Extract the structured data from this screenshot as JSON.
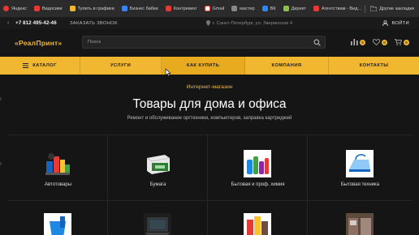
{
  "bookmarks": {
    "items": [
      {
        "label": "Яндекс",
        "color": "#e53935"
      },
      {
        "label": "Видосики",
        "color": "#e53935"
      },
      {
        "label": "Тупить в графики",
        "color": "#f1b731"
      },
      {
        "label": "Бизнес бабки",
        "color": "#3b82f6"
      },
      {
        "label": "Контрекинг",
        "color": "#e53935"
      },
      {
        "label": "Gmail",
        "color": "#ea4335"
      },
      {
        "label": "мастер",
        "color": "#888888"
      },
      {
        "label": "ВК",
        "color": "#2787f5"
      },
      {
        "label": "Директ",
        "color": "#8bc34a"
      },
      {
        "label": "Агентствам - Вид...",
        "color": "#e53935"
      }
    ],
    "other_label": "Другие закладки"
  },
  "topbar": {
    "phone": "+7 812 495-42-46",
    "callback": "ЗАКАЗАТЬ ЗВОНОК",
    "address": "г. Санкт-Петербург, ул. Зверинская 4",
    "login": "ВОЙТИ"
  },
  "header": {
    "logo": "«РеалПринт»",
    "search_placeholder": "Поиск",
    "compare_count": "0",
    "favorites_count": "0",
    "cart_count": "0"
  },
  "nav": {
    "items": [
      {
        "label": "КАТАЛОГ"
      },
      {
        "label": "УСЛУГИ"
      },
      {
        "label": "КАК КУПИТЬ"
      },
      {
        "label": "КОМПАНИЯ"
      },
      {
        "label": "КОНТАКТЫ"
      }
    ]
  },
  "hero": {
    "eyebrow": "Интернет-магазин",
    "title": "Товары для дома и офиса",
    "subtitle": "Ремонт и обслуживание оргтехники, компьютеров, заправка картриджей"
  },
  "categories": [
    {
      "label": "Автотовары",
      "icon": "car-goods-icon"
    },
    {
      "label": "Бумага",
      "icon": "paper-icon"
    },
    {
      "label": "Бытовая и проф. химия",
      "icon": "chemicals-icon"
    },
    {
      "label": "Бытовая техника",
      "icon": "appliances-icon"
    },
    {
      "label": "",
      "icon": "bucket-icon"
    },
    {
      "label": "",
      "icon": "laptop-icon"
    },
    {
      "label": "",
      "icon": "food-icon"
    },
    {
      "label": "",
      "icon": "furniture-icon"
    }
  ]
}
